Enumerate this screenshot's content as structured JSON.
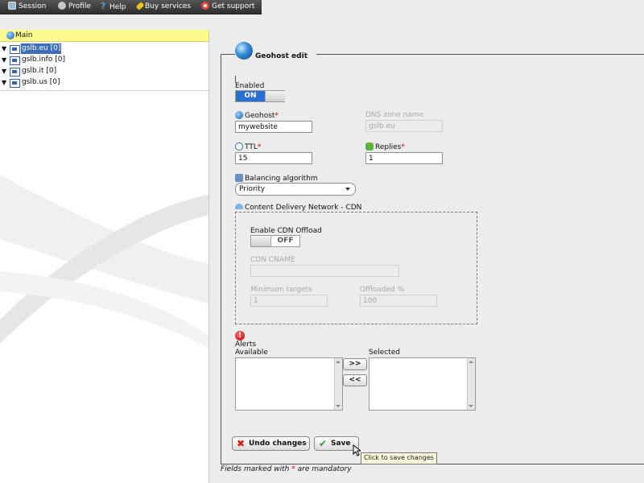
{
  "topbar": {
    "items": [
      {
        "label": "Session",
        "icon": "session-icon",
        "color": "#9fb8d8"
      },
      {
        "label": "Profile",
        "icon": "profile-icon",
        "color": "#c7c7c7"
      },
      {
        "label": "Help",
        "icon": "help-icon",
        "color": "#5aa0e0"
      },
      {
        "label": "Buy services",
        "icon": "buy-services-icon",
        "color": "#f3c21a"
      },
      {
        "label": "Get support",
        "icon": "lifebuoy-icon",
        "color": "#e0463a"
      }
    ]
  },
  "tree": {
    "root": "Main",
    "items": [
      {
        "label": "gslb.eu [0]",
        "selected": true
      },
      {
        "label": "gslb.info [0]",
        "selected": false
      },
      {
        "label": "gslb.it [0]",
        "selected": false
      },
      {
        "label": "gslb.us [0]",
        "selected": false
      }
    ]
  },
  "form": {
    "title": "Geohost edit",
    "enabled": {
      "label": "Enabled",
      "state": "ON"
    },
    "geohost": {
      "label": "Geohost",
      "required_mark": "*",
      "value": "mywebsite"
    },
    "dns_zone": {
      "label": "DNS zone name",
      "value": "gslb.eu"
    },
    "ttl": {
      "label": "TTL",
      "required_mark": "*",
      "value": "15"
    },
    "replies": {
      "label": "Replies",
      "required_mark": "*",
      "value": "1"
    },
    "balancing": {
      "label": "Balancing algorithm",
      "value": "Priority"
    },
    "cdn": {
      "title": "Content Delivery Network - CDN",
      "enable_label": "Enable CDN Offload",
      "enable_state": "OFF",
      "cname_label": "CDN CNAME",
      "cname_value": "",
      "min_targets_label": "Minimum targets",
      "min_targets_value": "1",
      "offloaded_label": "Offloaded %",
      "offloaded_value": "100"
    },
    "alerts": {
      "label": "Alerts",
      "available_label": "Available",
      "selected_label": "Selected",
      "add_label": ">>",
      "remove_label": "<<"
    },
    "undo_label": "Undo changes",
    "save_label": "Save",
    "tooltip": "Click to save changes",
    "mandatory_prefix": "Fields marked with",
    "mandatory_star": "*",
    "mandatory_suffix": "are mandatory"
  },
  "colors": {
    "accent": "#2a6fd4",
    "tree_header": "#fdfb8f",
    "required": "#cc0000"
  }
}
